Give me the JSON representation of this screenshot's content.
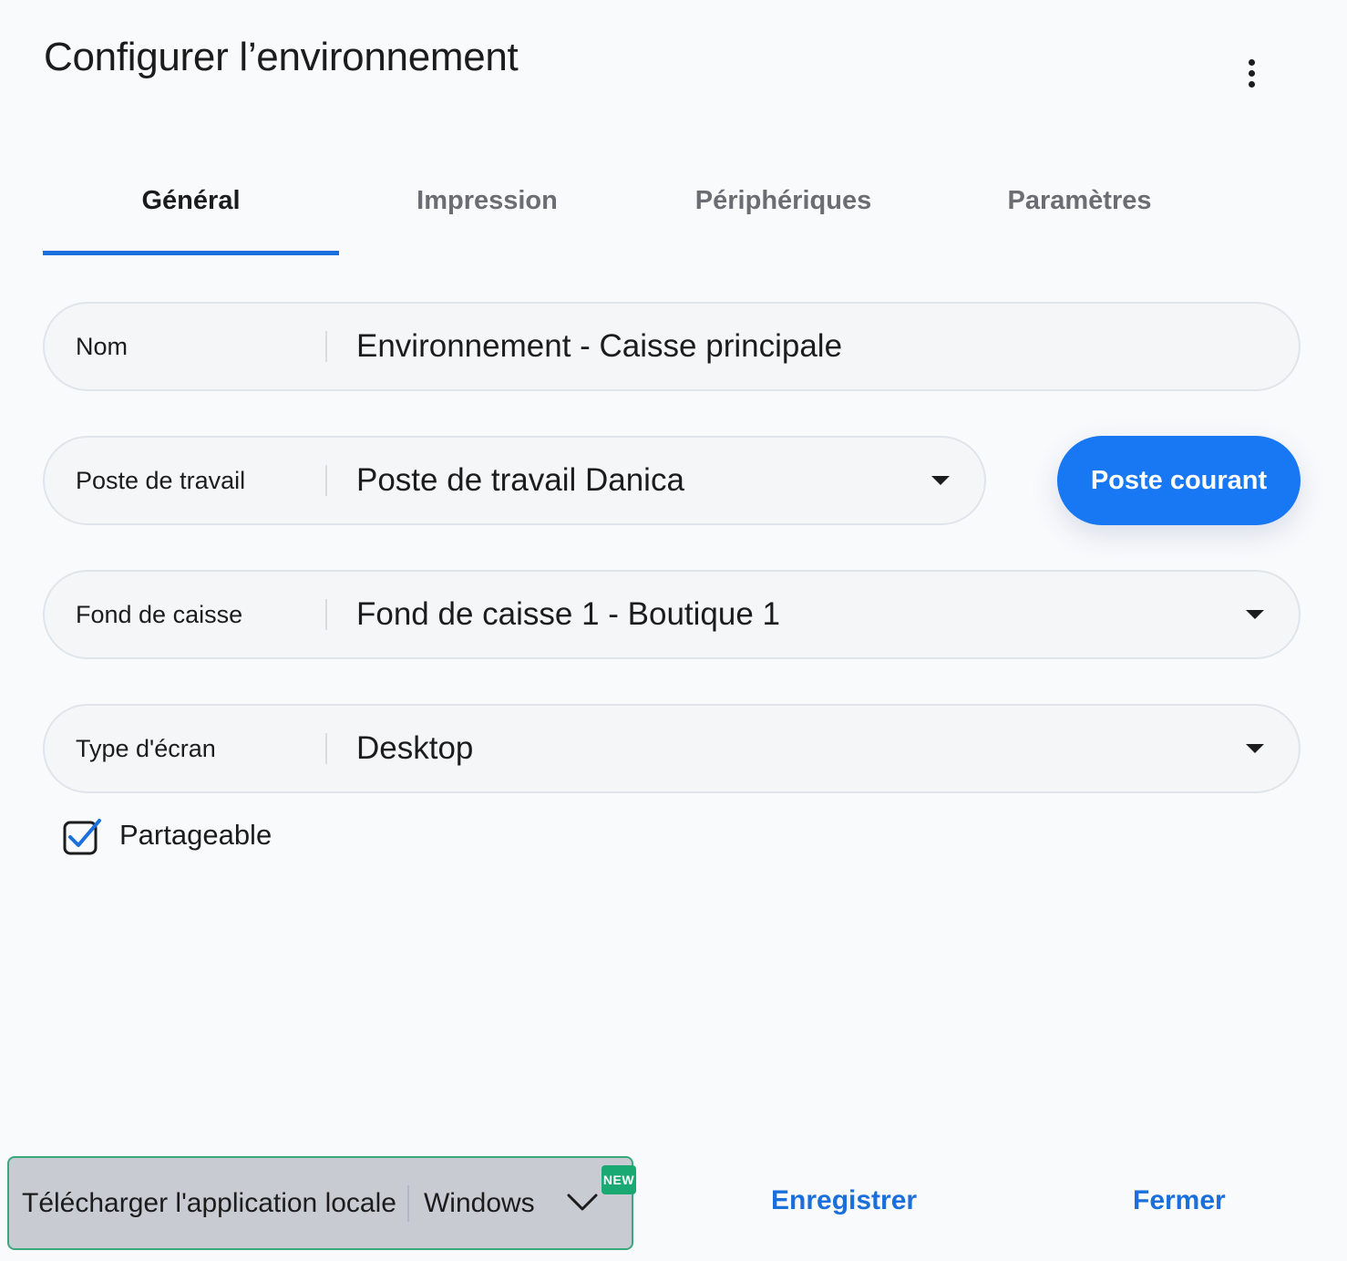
{
  "header": {
    "title": "Configurer l’environnement",
    "menu_icon": "more-vertical-icon"
  },
  "tabs": [
    {
      "label": "Général",
      "active": true
    },
    {
      "label": "Impression",
      "active": false
    },
    {
      "label": "Périphériques",
      "active": false
    },
    {
      "label": "Paramètres",
      "active": false
    }
  ],
  "form": {
    "nom": {
      "label": "Nom",
      "value": "Environnement - Caisse principale"
    },
    "poste": {
      "label": "Poste de travail",
      "value": "Poste de travail Danica"
    },
    "fond": {
      "label": "Fond de caisse",
      "value": "Fond de caisse 1 - Boutique 1"
    },
    "type_ecran": {
      "label": "Type d'écran",
      "value": "Desktop"
    },
    "partageable": {
      "label": "Partageable",
      "checked": true
    },
    "poste_courant_button": "Poste courant"
  },
  "footer": {
    "download_label": "Télécharger l'application locale",
    "download_os": "Windows",
    "new_badge": "NEW",
    "save_label": "Enregistrer",
    "close_label": "Fermer"
  },
  "colors": {
    "accent": "#1877f2",
    "tab_underline": "#1a6fdc",
    "badge_green": "#1aa873"
  }
}
